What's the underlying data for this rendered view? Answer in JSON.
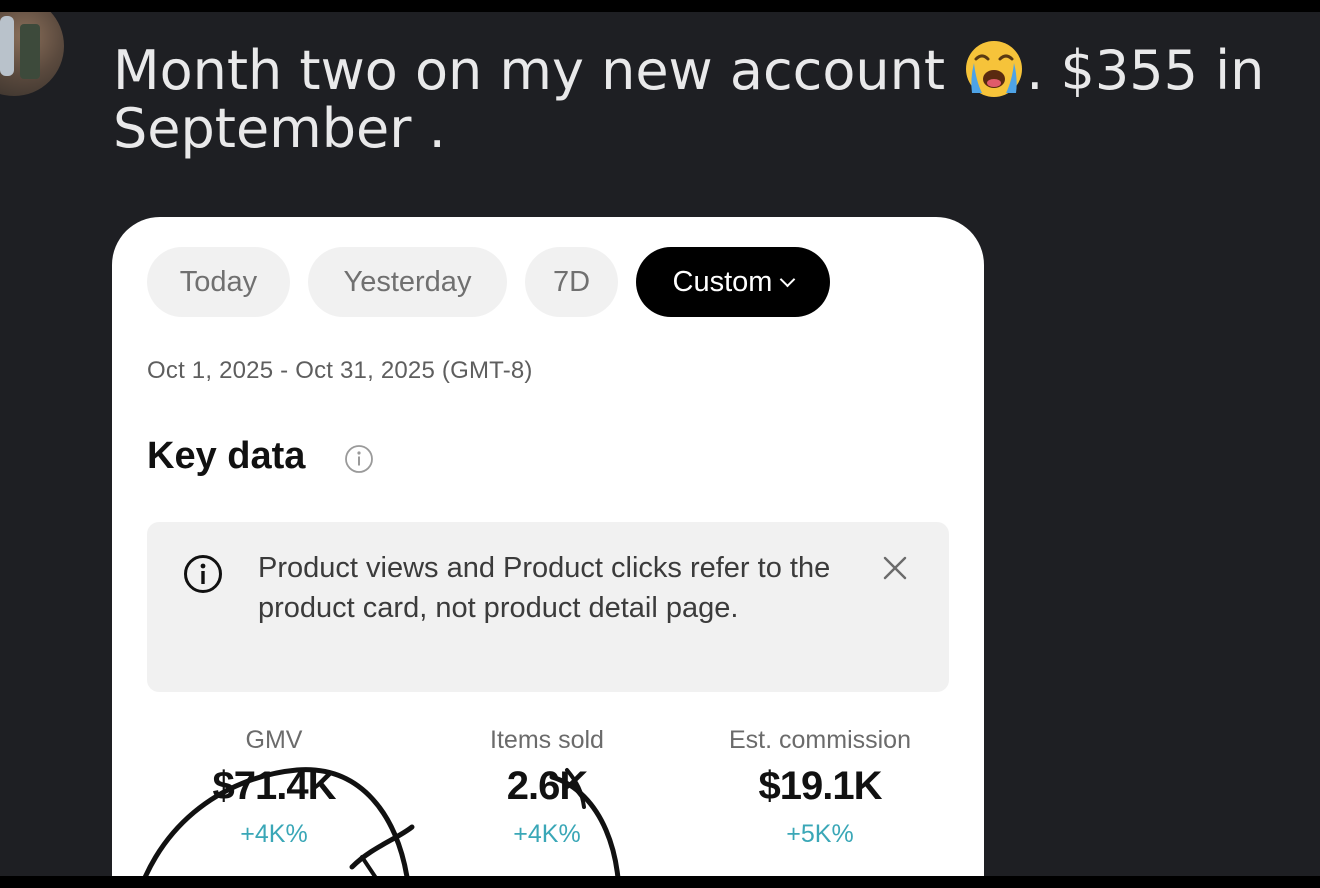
{
  "post": {
    "text_line1_a": "Month two on my new account ",
    "emoji": "loudly-crying-face",
    "text_line1_b": ". $355 in",
    "text_line2": "September ."
  },
  "card": {
    "chips": [
      {
        "label": "Today",
        "selected": false
      },
      {
        "label": "Yesterday",
        "selected": false
      },
      {
        "label": "7D",
        "selected": false
      },
      {
        "label": "Custom",
        "selected": true
      }
    ],
    "date_range": "Oct 1, 2025 - Oct 31, 2025 (GMT-8)",
    "key_data_title": "Key data",
    "notice": {
      "text": "Product views and Product clicks refer to the product card, not product detail page."
    },
    "metrics": [
      {
        "label": "GMV",
        "value": "$71.4K",
        "delta": "+4K%"
      },
      {
        "label": "Items sold",
        "value": "2.6K",
        "delta": "+4K%"
      },
      {
        "label": "Est. commission",
        "value": "$19.1K",
        "delta": "+5K%"
      }
    ]
  },
  "colors": {
    "background": "#1e1f23",
    "card": "#ffffff",
    "chip": "#f1f1f1",
    "chip_selected": "#000000",
    "delta": "#3aa7b7"
  },
  "icons": [
    "info-icon",
    "close-icon",
    "chevron-down-icon",
    "loudly-crying-face-emoji"
  ]
}
